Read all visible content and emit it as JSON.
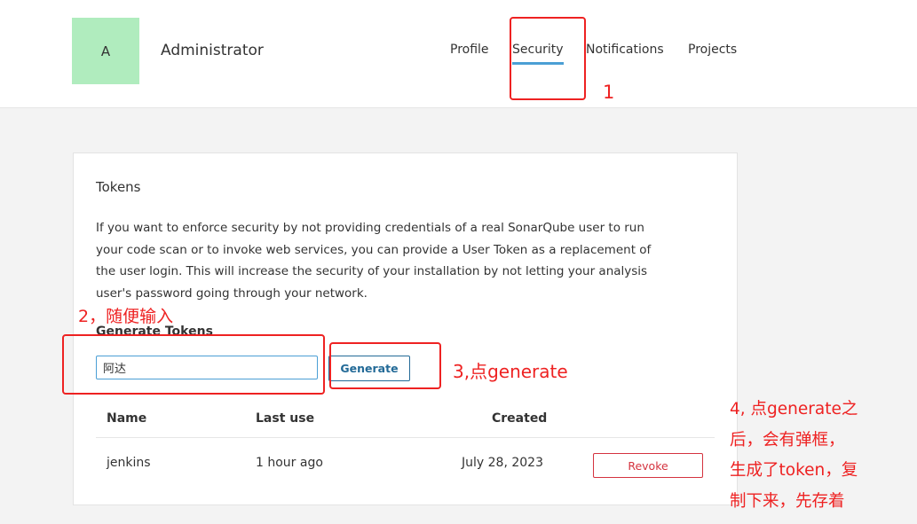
{
  "user": {
    "avatar_letter": "A",
    "name": "Administrator"
  },
  "nav": {
    "tabs": [
      {
        "label": "Profile",
        "active": false
      },
      {
        "label": "Security",
        "active": true
      },
      {
        "label": "Notifications",
        "active": false
      },
      {
        "label": "Projects",
        "active": false
      }
    ]
  },
  "tokens": {
    "title": "Tokens",
    "description_lines": [
      "If you want to enforce security by not providing credentials of a real SonarQube user to run",
      "your code scan or to invoke web services, you can provide a User Token as a replacement of",
      "the user login. This will increase the security of your installation by not letting your analysis",
      "user's password going through your network."
    ],
    "generate_title": "Generate Tokens",
    "input_value": "阿达",
    "generate_label": "Generate",
    "table": {
      "headers": [
        "Name",
        "Last use",
        "Created"
      ],
      "rows": [
        {
          "name": "jenkins",
          "last_use": "1 hour ago",
          "created": "July 28, 2023",
          "action": "Revoke"
        }
      ]
    }
  },
  "annotations": {
    "step1": "1",
    "step2": "2，随便输入",
    "step3": "3,点generate",
    "step4_lines": [
      "4, 点generate之",
      "后，会有弹框，",
      "生成了token，复",
      "制下来，先存着"
    ]
  },
  "colors": {
    "accent": "#4b9fd5",
    "generate_border": "#236a97",
    "revoke": "#d4333f",
    "annotation": "#ee2222",
    "avatar_bg": "#b0ecbe"
  }
}
